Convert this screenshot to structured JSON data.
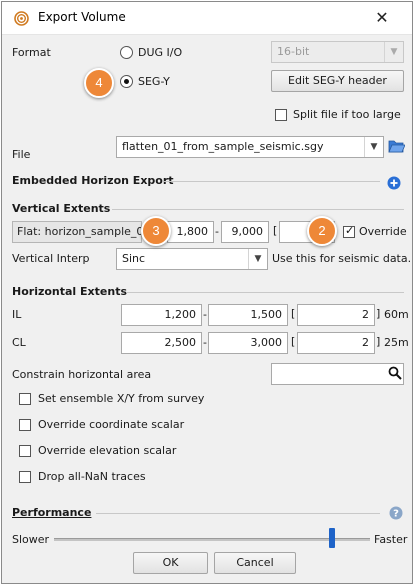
{
  "window": {
    "title": "Export Volume",
    "close_glyph": "✕",
    "app_icon": "target-icon",
    "close_icon": "close-icon"
  },
  "format": {
    "label": "Format",
    "options": [
      {
        "label": "DUG I/O",
        "selected": false
      },
      {
        "label": "SEG-Y",
        "selected": true
      }
    ],
    "bit_depth": {
      "value": "16-bit",
      "enabled": false
    },
    "edit_segy_button": "Edit SEG-Y header",
    "split_file_label": "Split file if too large",
    "split_file_checked": false
  },
  "file": {
    "label": "File",
    "value": "flatten_01_from_sample_seismic.sgy",
    "browse_icon": "folder-open-icon"
  },
  "embedded_horizon": {
    "heading": "Embedded Horizon Export",
    "add_icon": "plus-circle-icon"
  },
  "vertical": {
    "heading": "Vertical Extents",
    "flat_label": "Flat: horizon_sample_01",
    "range_from": "1,800",
    "range_dash": "-",
    "range_to": "9,000",
    "bracket_open": "[",
    "step": "",
    "override_label": "Override",
    "override_checked": true,
    "interp_label": "Vertical Interp",
    "interp_value": "Sinc",
    "interp_note": "Use this for seismic data."
  },
  "horizontal": {
    "heading": "Horizontal Extents",
    "rows": [
      {
        "label": "IL",
        "from": "1,200",
        "dash": "-",
        "to": "1,500",
        "bracket_open": "[",
        "step": "2",
        "bracket_close": "]",
        "spacing": "60m"
      },
      {
        "label": "CL",
        "from": "2,500",
        "dash": "-",
        "to": "3,000",
        "bracket_open": "[",
        "step": "2",
        "bracket_close": "]",
        "spacing": "25m"
      }
    ],
    "constrain_label": "Constrain horizontal area",
    "constrain_value": "",
    "search_icon": "search-icon"
  },
  "options": [
    {
      "label": "Set ensemble X/Y from survey",
      "checked": false
    },
    {
      "label": "Override coordinate scalar",
      "checked": false
    },
    {
      "label": "Override elevation scalar",
      "checked": false
    },
    {
      "label": "Drop all-NaN traces",
      "checked": false
    }
  ],
  "performance": {
    "heading": "Performance",
    "help_icon": "help-icon",
    "slower_label": "Slower",
    "faster_label": "Faster",
    "slider_level": 0.88
  },
  "buttons": {
    "ok": "OK",
    "cancel": "Cancel"
  },
  "callouts": [
    "4",
    "3",
    "2"
  ],
  "colors": {
    "callout": "#ee8838",
    "accent_blue": "#2a6fd6",
    "slider_thumb": "#1e63c8"
  }
}
